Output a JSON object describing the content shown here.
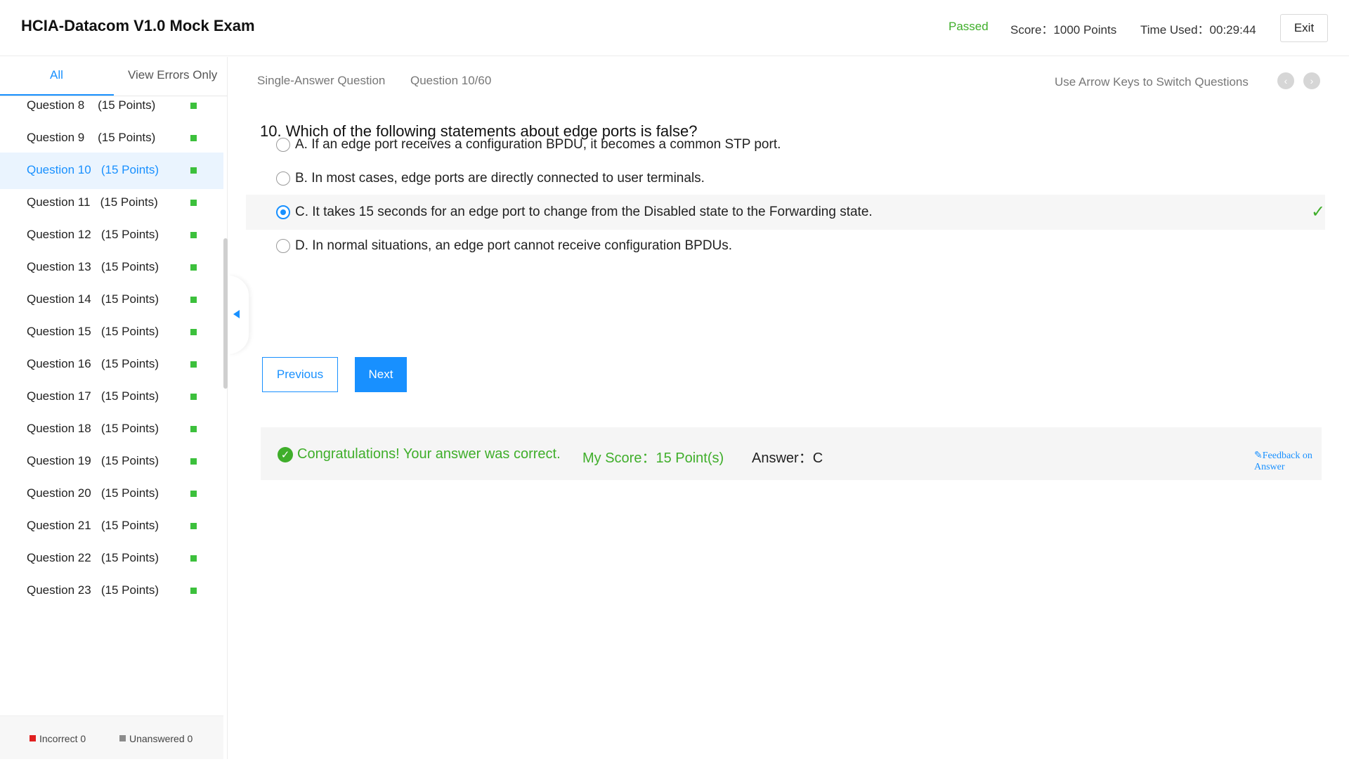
{
  "header": {
    "title": "HCIA-Datacom V1.0 Mock Exam",
    "status": "Passed",
    "score": "Score：1000 Points",
    "time_used": "Time Used：00:29:44",
    "exit_label": "Exit"
  },
  "sidebar": {
    "tabs": {
      "all": "All",
      "errors": "View Errors Only"
    },
    "questions": [
      {
        "label": "Question 8    (15 Points)",
        "active": false
      },
      {
        "label": "Question 9    (15 Points)",
        "active": false
      },
      {
        "label": "Question 10   (15 Points)",
        "active": true
      },
      {
        "label": "Question 11   (15 Points)",
        "active": false
      },
      {
        "label": "Question 12   (15 Points)",
        "active": false
      },
      {
        "label": "Question 13   (15 Points)",
        "active": false
      },
      {
        "label": "Question 14   (15 Points)",
        "active": false
      },
      {
        "label": "Question 15   (15 Points)",
        "active": false
      },
      {
        "label": "Question 16   (15 Points)",
        "active": false
      },
      {
        "label": "Question 17   (15 Points)",
        "active": false
      },
      {
        "label": "Question 18   (15 Points)",
        "active": false
      },
      {
        "label": "Question 19   (15 Points)",
        "active": false
      },
      {
        "label": "Question 20   (15 Points)",
        "active": false
      },
      {
        "label": "Question 21   (15 Points)",
        "active": false
      },
      {
        "label": "Question 22   (15 Points)",
        "active": false
      },
      {
        "label": "Question 23   (15 Points)",
        "active": false
      }
    ],
    "legend": {
      "incorrect": "Incorrect 0",
      "unanswered": "Unanswered 0",
      "incorrect_color": "#e02020",
      "unanswered_color": "#8c8c8c"
    }
  },
  "main": {
    "question_type": "Single-Answer Question",
    "question_number": "Question 10/60",
    "nav_hint": "Use Arrow Keys to Switch Questions",
    "question_text": "10. Which of the following statements about edge ports is false?",
    "options": [
      {
        "text": "A. If an edge port receives a configuration BPDU, it becomes a common STP port.",
        "selected": false
      },
      {
        "text": "B. In most cases, edge ports are directly connected to user terminals.",
        "selected": false
      },
      {
        "text": "C. It takes 15 seconds for an edge port to change from the Disabled state to the Forwarding state.",
        "selected": true
      },
      {
        "text": "D. In normal situations, an edge port cannot receive configuration BPDUs.",
        "selected": false
      }
    ],
    "previous_label": "Previous",
    "next_label": "Next",
    "result": {
      "message": "Congratulations! Your answer was correct.",
      "my_score": "My Score：15 Point(s)",
      "answer": "Answer：C",
      "feedback": "Feedback on Answer"
    }
  },
  "colors": {
    "accent": "#1890ff",
    "success": "#3fae2a",
    "status_dot": "#3cc03c"
  }
}
